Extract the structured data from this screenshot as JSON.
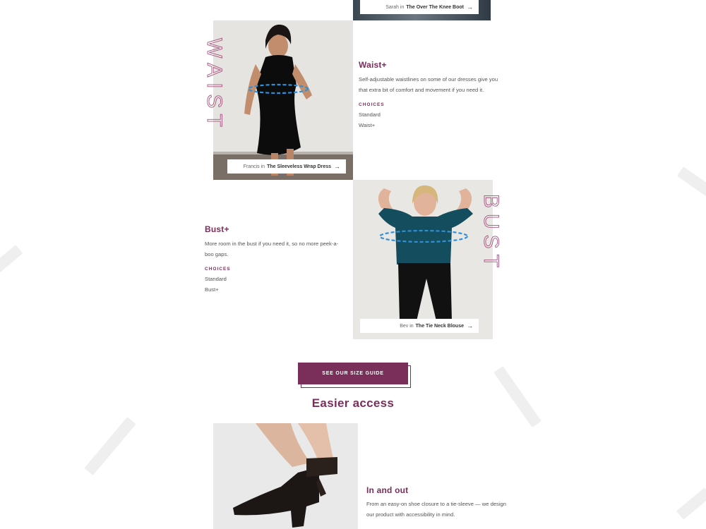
{
  "top_caption": {
    "person": "Sarah in",
    "product": "The Over The Knee Boot",
    "arrow": "→"
  },
  "waist": {
    "vertical_label": "WAIST",
    "title": "Waist+",
    "description": "Self-adjustable waistlines on some of our dresses give you that extra bit of comfort and movement if you need it.",
    "choices_label": "CHOICES",
    "options": [
      "Standard",
      "Waist+"
    ],
    "caption": {
      "person": "Francis in",
      "product": "The Sleeveless Wrap Dress",
      "arrow": "→"
    }
  },
  "bust": {
    "vertical_label": "BUST",
    "title": "Bust+",
    "description": "More room in the bust if you need it, so no more peek-a-boo gaps.",
    "choices_label": "CHOICES",
    "options": [
      "Standard",
      "Bust+"
    ],
    "caption": {
      "person": "Bev in",
      "product": "The Tie Neck Blouse",
      "arrow": "→"
    }
  },
  "size_guide_button": "SEE OUR SIZE GUIDE",
  "easier_access": {
    "heading": "Easier access",
    "in_and_out": {
      "title": "In and out",
      "description": "From an easy-on shoe closure to a tie-sleeve — we design our product with accessibility in mind."
    }
  },
  "colors": {
    "brand": "#7a2e5a",
    "waist_line": "#2f8fd8"
  }
}
